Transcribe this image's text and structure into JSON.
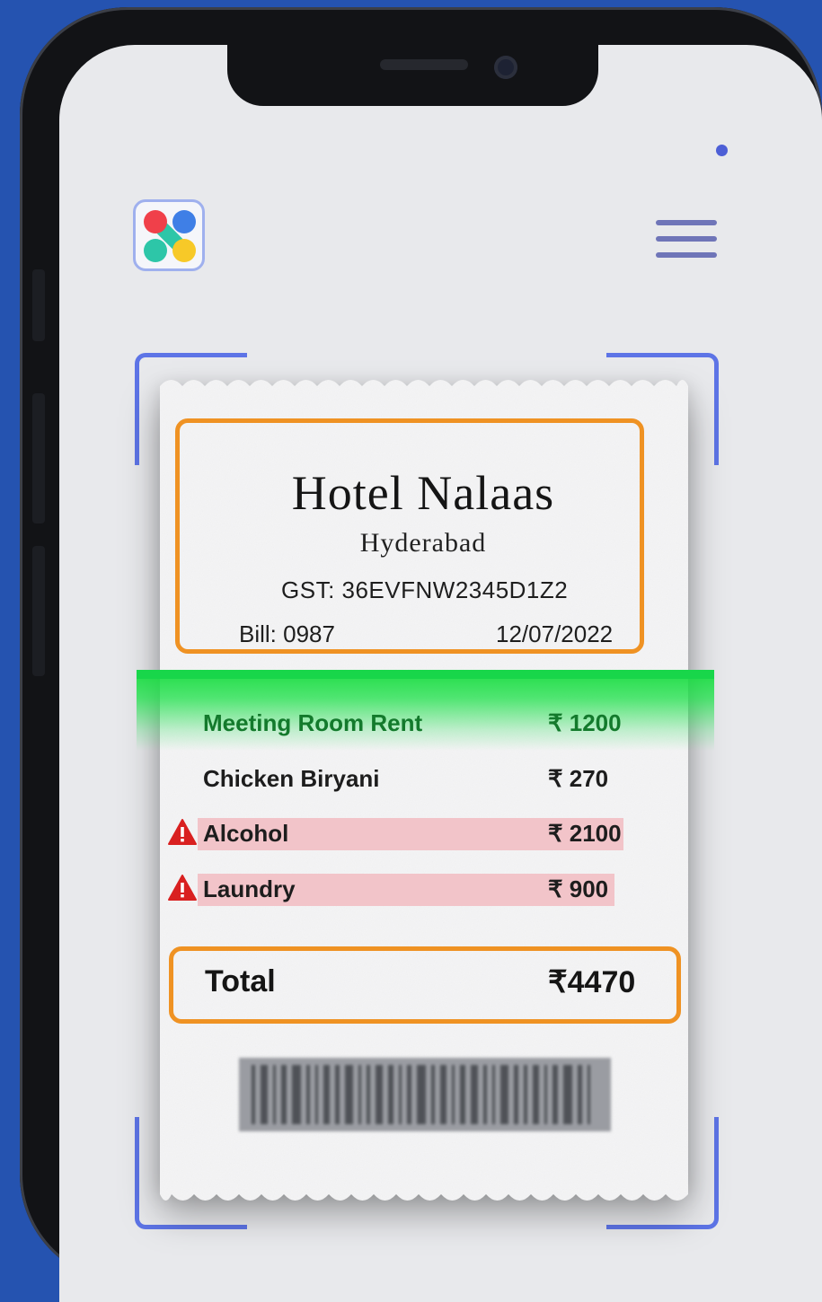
{
  "app": {
    "menu_icon": "hamburger-menu-icon",
    "logo_icon": "app-logo-icon",
    "colors": {
      "background": "#2553b0",
      "scan_frame": "#5d74e6",
      "highlight_box": "#ef9223",
      "scan_band": "#18d64a",
      "flag_highlight": "#f2c4c9",
      "warning": "#d92020"
    }
  },
  "receipt": {
    "hotel_name": "Hotel Nalaas",
    "city": "Hyderabad",
    "gst": "GST:  36EVFNW2345D1Z2",
    "bill": "Bill: 0987",
    "date": "12/07/2022",
    "items": [
      {
        "name": "Meeting Room Rent",
        "price": "₹ 1200",
        "state": "scanning"
      },
      {
        "name": "Chicken Biryani",
        "price": "₹ 270",
        "state": "normal"
      },
      {
        "name": "Alcohol",
        "price": "₹ 2100",
        "state": "flagged",
        "icon": "warning-triangle-icon"
      },
      {
        "name": "Laundry",
        "price": "₹ 900",
        "state": "flagged",
        "icon": "warning-triangle-icon"
      }
    ],
    "total_label": "Total",
    "total_value": "₹4470"
  }
}
